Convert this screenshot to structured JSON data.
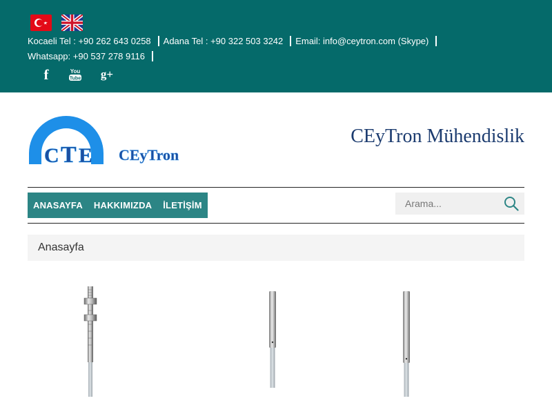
{
  "header": {
    "languages": [
      "turkish-flag",
      "english-flag"
    ],
    "contacts": [
      {
        "label": "Kocaeli Tel : +90 262 643 0258"
      },
      {
        "label": "Adana Tel : +90 322 503 3242"
      },
      {
        "label": "Email:  info@ceytron.com (Skype)"
      }
    ],
    "whatsapp": "Whatsapp:  +90 537 278 9116",
    "social": [
      "facebook-icon",
      "youtube-icon",
      "google-plus-icon"
    ],
    "background_color": "#056a6a"
  },
  "brand": {
    "logo_letters": "CTE",
    "logo_name": "CEyTron",
    "site_title": "CEyTron Mühendislik"
  },
  "nav": {
    "items": [
      {
        "label": "ANASAYFA"
      },
      {
        "label": "HAKKIMIZDA"
      },
      {
        "label": "İLETİŞİM"
      }
    ]
  },
  "search": {
    "placeholder": "Arama..."
  },
  "breadcrumb": {
    "current": "Anasayfa"
  },
  "products": [
    "threaded-inductive-sensor",
    "smooth-inductive-sensor",
    "smooth-inductive-sensor"
  ]
}
